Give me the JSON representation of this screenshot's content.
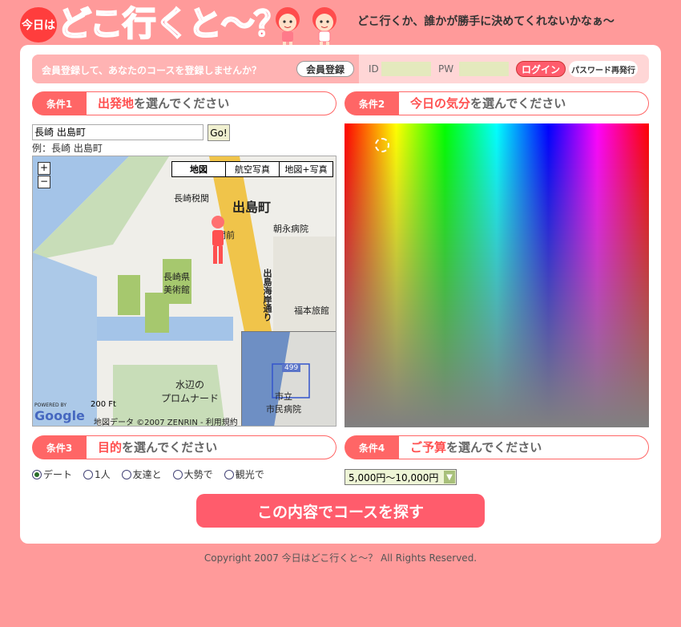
{
  "header": {
    "badge": "今日は",
    "logo": "どこ行くと〜？",
    "tagline": "どこ行くか、誰かが勝手に決めてくれないかなぁ〜"
  },
  "member": {
    "prompt": "会員登録して、あなたのコースを登録しませんか？",
    "register_label": "会員登録",
    "id_label": "ID",
    "pw_label": "PW",
    "login_label": "ログイン",
    "reset_label": "パスワード再発行"
  },
  "conditions": {
    "c1": {
      "tag": "条件1",
      "highlight": "出発地",
      "rest": "を選んでください"
    },
    "c2": {
      "tag": "条件2",
      "highlight": "今日の気分",
      "rest": "を選んでください"
    },
    "c3": {
      "tag": "条件3",
      "highlight": "目的",
      "rest": "を選んでください"
    },
    "c4": {
      "tag": "条件4",
      "highlight": "ご予算",
      "rest": "を選んでください"
    }
  },
  "search": {
    "value": "長崎 出島町",
    "go_label": "Go!",
    "example": "例：長崎 出島町"
  },
  "map": {
    "tabs": [
      "地図",
      "航空写真",
      "地図+写真"
    ],
    "zoom_in": "+",
    "zoom_out": "−",
    "labels": {
      "customs": "長崎税関",
      "dejima": "出島町",
      "hospital": "朝永病院",
      "museum": "長崎県\n美術館",
      "road": "出島海岸通り",
      "inn": "福本旅館",
      "promenade": "水辺の\nプロムナード",
      "city_hospital": "市立\n市民病院",
      "route": "499",
      "mae": "関前"
    },
    "scale": "200 Ft",
    "powered": "POWERED BY",
    "google": "Google",
    "copyright": "地図データ ©2007 ZENRIN - 利用規約"
  },
  "purposes": [
    {
      "label": "デート",
      "checked": true
    },
    {
      "label": "1人",
      "checked": false
    },
    {
      "label": "友達と",
      "checked": false
    },
    {
      "label": "大勢で",
      "checked": false
    },
    {
      "label": "観光で",
      "checked": false
    }
  ],
  "budget": {
    "selected": "5,000円〜10,000円"
  },
  "submit_label": "この内容でコースを探す",
  "footer": "Copyright 2007 今日はどこ行くと〜？ All Rights Reserved."
}
